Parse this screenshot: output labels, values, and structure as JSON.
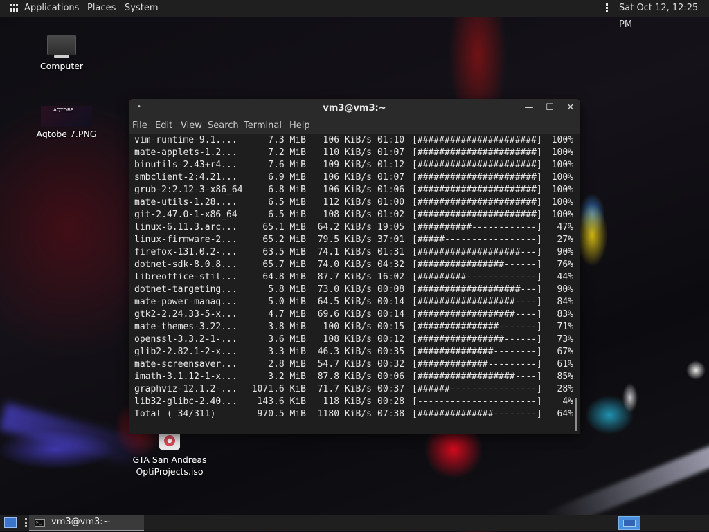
{
  "top_panel": {
    "menus": [
      "Applications",
      "Places",
      "System"
    ],
    "clock": "Sat Oct 12, 12:25 PM"
  },
  "desktop": {
    "icons": [
      {
        "label": "Computer"
      },
      {
        "label": "Aqtobe 7.PNG",
        "thumb_text": "AQTOBE"
      },
      {
        "label_line1": "GTA San Andreas",
        "label_line2": "OptiProjects.iso"
      }
    ]
  },
  "terminal": {
    "title": "vm3@vm3:~",
    "title_dot": "•",
    "buttons": {
      "minimize": "—",
      "maximize": "☐",
      "close": "✕"
    },
    "menus": [
      "File",
      "Edit",
      "View",
      "Search",
      "Terminal",
      "Help"
    ],
    "rows": [
      {
        "name": "vim-runtime-9.1....",
        "size": "7.3 MiB",
        "rate": "106 KiB/s",
        "time": "01:10",
        "bar": "[######################]",
        "pct": "100%"
      },
      {
        "name": "mate-applets-1.2...",
        "size": "7.2 MiB",
        "rate": "110 KiB/s",
        "time": "01:07",
        "bar": "[######################]",
        "pct": "100%"
      },
      {
        "name": "binutils-2.43+r4...",
        "size": "7.6 MiB",
        "rate": "109 KiB/s",
        "time": "01:12",
        "bar": "[######################]",
        "pct": "100%"
      },
      {
        "name": "smbclient-2:4.21...",
        "size": "6.9 MiB",
        "rate": "106 KiB/s",
        "time": "01:07",
        "bar": "[######################]",
        "pct": "100%"
      },
      {
        "name": "grub-2:2.12-3-x86_64",
        "size": "6.8 MiB",
        "rate": "106 KiB/s",
        "time": "01:06",
        "bar": "[######################]",
        "pct": "100%"
      },
      {
        "name": "mate-utils-1.28....",
        "size": "6.5 MiB",
        "rate": "112 KiB/s",
        "time": "01:00",
        "bar": "[######################]",
        "pct": "100%"
      },
      {
        "name": "git-2.47.0-1-x86_64",
        "size": "6.5 MiB",
        "rate": "108 KiB/s",
        "time": "01:02",
        "bar": "[######################]",
        "pct": "100%"
      },
      {
        "name": "linux-6.11.3.arc...",
        "size": "65.1 MiB",
        "rate": "64.2 KiB/s",
        "time": "19:05",
        "bar": "[##########------------]",
        "pct": "47%"
      },
      {
        "name": "linux-firmware-2...",
        "size": "65.2 MiB",
        "rate": "79.5 KiB/s",
        "time": "37:01",
        "bar": "[#####-----------------]",
        "pct": "27%"
      },
      {
        "name": "firefox-131.0.2-...",
        "size": "63.5 MiB",
        "rate": "74.1 KiB/s",
        "time": "01:31",
        "bar": "[###################---]",
        "pct": "90%"
      },
      {
        "name": "dotnet-sdk-8.0.8...",
        "size": "65.7 MiB",
        "rate": "74.0 KiB/s",
        "time": "04:32",
        "bar": "[################------]",
        "pct": "76%"
      },
      {
        "name": "libreoffice-stil...",
        "size": "64.8 MiB",
        "rate": "87.7 KiB/s",
        "time": "16:02",
        "bar": "[#########-------------]",
        "pct": "44%"
      },
      {
        "name": "dotnet-targeting...",
        "size": "5.8 MiB",
        "rate": "73.0 KiB/s",
        "time": "00:08",
        "bar": "[###################---]",
        "pct": "90%"
      },
      {
        "name": "mate-power-manag...",
        "size": "5.0 MiB",
        "rate": "64.5 KiB/s",
        "time": "00:14",
        "bar": "[##################----]",
        "pct": "84%"
      },
      {
        "name": "gtk2-2.24.33-5-x...",
        "size": "4.7 MiB",
        "rate": "69.6 KiB/s",
        "time": "00:14",
        "bar": "[##################----]",
        "pct": "83%"
      },
      {
        "name": "mate-themes-3.22...",
        "size": "3.8 MiB",
        "rate": "100 KiB/s",
        "time": "00:15",
        "bar": "[###############-------]",
        "pct": "71%"
      },
      {
        "name": "openssl-3.3.2-1-...",
        "size": "3.6 MiB",
        "rate": "108 KiB/s",
        "time": "00:12",
        "bar": "[################------]",
        "pct": "73%"
      },
      {
        "name": "glib2-2.82.1-2-x...",
        "size": "3.3 MiB",
        "rate": "46.3 KiB/s",
        "time": "00:35",
        "bar": "[##############--------]",
        "pct": "67%"
      },
      {
        "name": "mate-screensaver...",
        "size": "2.8 MiB",
        "rate": "54.7 KiB/s",
        "time": "00:32",
        "bar": "[#############---------]",
        "pct": "61%"
      },
      {
        "name": "imath-3.1.12-1-x...",
        "size": "3.2 MiB",
        "rate": "87.8 KiB/s",
        "time": "00:06",
        "bar": "[##################----]",
        "pct": "85%"
      },
      {
        "name": "graphviz-12.1.2-...",
        "size": "1071.6 KiB",
        "rate": "71.7 KiB/s",
        "time": "00:37",
        "bar": "[######----------------]",
        "pct": "28%"
      },
      {
        "name": "lib32-glibc-2.40...",
        "size": "143.6 KiB",
        "rate": "118 KiB/s",
        "time": "00:28",
        "bar": "[----------------------]",
        "pct": "4%"
      },
      {
        "name": "Total ( 34/311)",
        "size": "970.5 MiB",
        "rate": "1180 KiB/s",
        "time": "07:38",
        "bar": "[##############--------]",
        "pct": "64%"
      }
    ]
  },
  "bottom_panel": {
    "task_label": "vm3@vm3:~",
    "task_icon_text": ">_"
  },
  "icons": {
    "applications": "grid-icon",
    "panel_menu": "kebab-icon",
    "computer": "monitor-icon",
    "image_file": "image-thumbnail-icon",
    "iso_file": "disc-image-icon",
    "show_desktop": "show-desktop-icon",
    "terminal_task": "terminal-icon",
    "workspace": "workspace-switcher-icon"
  }
}
